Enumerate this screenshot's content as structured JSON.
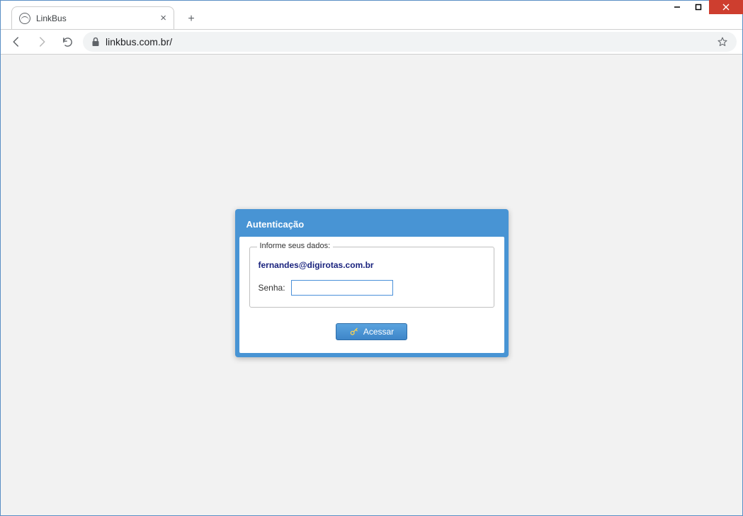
{
  "browser": {
    "tab_title": "LinkBus",
    "url": "linkbus.com.br/"
  },
  "auth_panel": {
    "title": "Autenticação",
    "fieldset_legend": "Informe seus dados:",
    "email_value": "fernandes@digirotas.com.br",
    "password_label": "Senha:",
    "password_value": "",
    "submit_label": "Acessar"
  }
}
